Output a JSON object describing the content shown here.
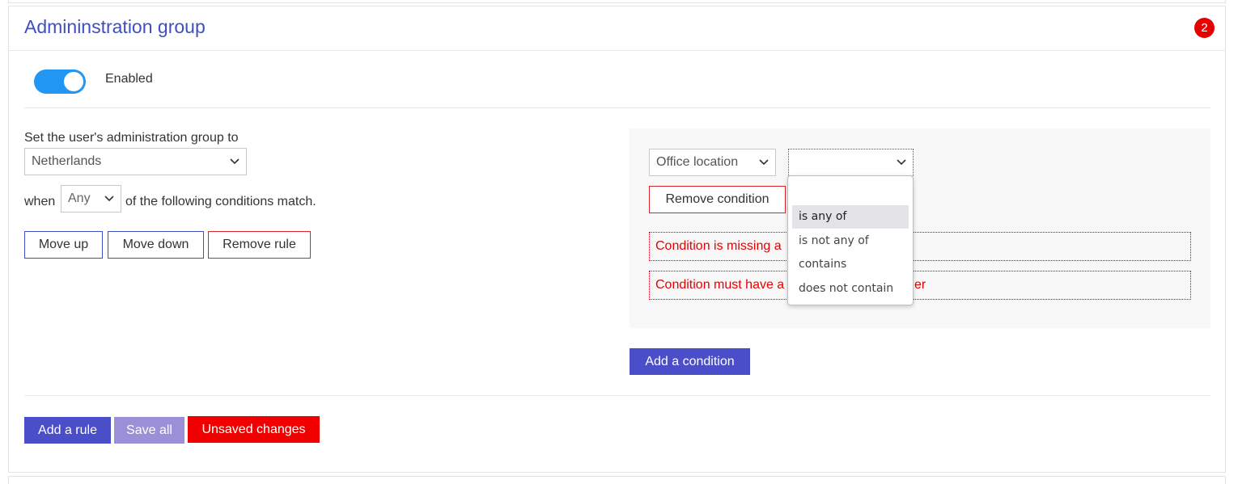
{
  "panel": {
    "title": "Admininstration group",
    "badge_count": "2"
  },
  "toggle": {
    "state": "on",
    "label": "Enabled"
  },
  "rule": {
    "set_label": "Set the user's administration group to",
    "group_value": "Netherlands",
    "when_label": "when",
    "match_value": "Any",
    "conditions_suffix": "of the following conditions match.",
    "move_up_label": "Move up",
    "move_down_label": "Move down",
    "remove_rule_label": "Remove rule"
  },
  "condition": {
    "field_value": "Office location",
    "operator_value": "",
    "remove_label": "Remove condition",
    "errors": [
      "Condition is missing a",
      "Condition must have a"
    ],
    "error_tail": "er"
  },
  "operator_dropdown": {
    "options": [
      "",
      "is any of",
      "is not any of",
      "contains",
      "does not contain"
    ],
    "highlighted": "is any of"
  },
  "add_condition_label": "Add a condition",
  "footer": {
    "add_rule_label": "Add a rule",
    "save_all_label": "Save all",
    "unsaved_label": "Unsaved changes"
  },
  "colors": {
    "title": "#3f4fbf",
    "accent": "#4a4ec8",
    "accent_disabled": "#9b8fd8",
    "danger": "#e60000",
    "toggle_on": "#2196f3"
  }
}
